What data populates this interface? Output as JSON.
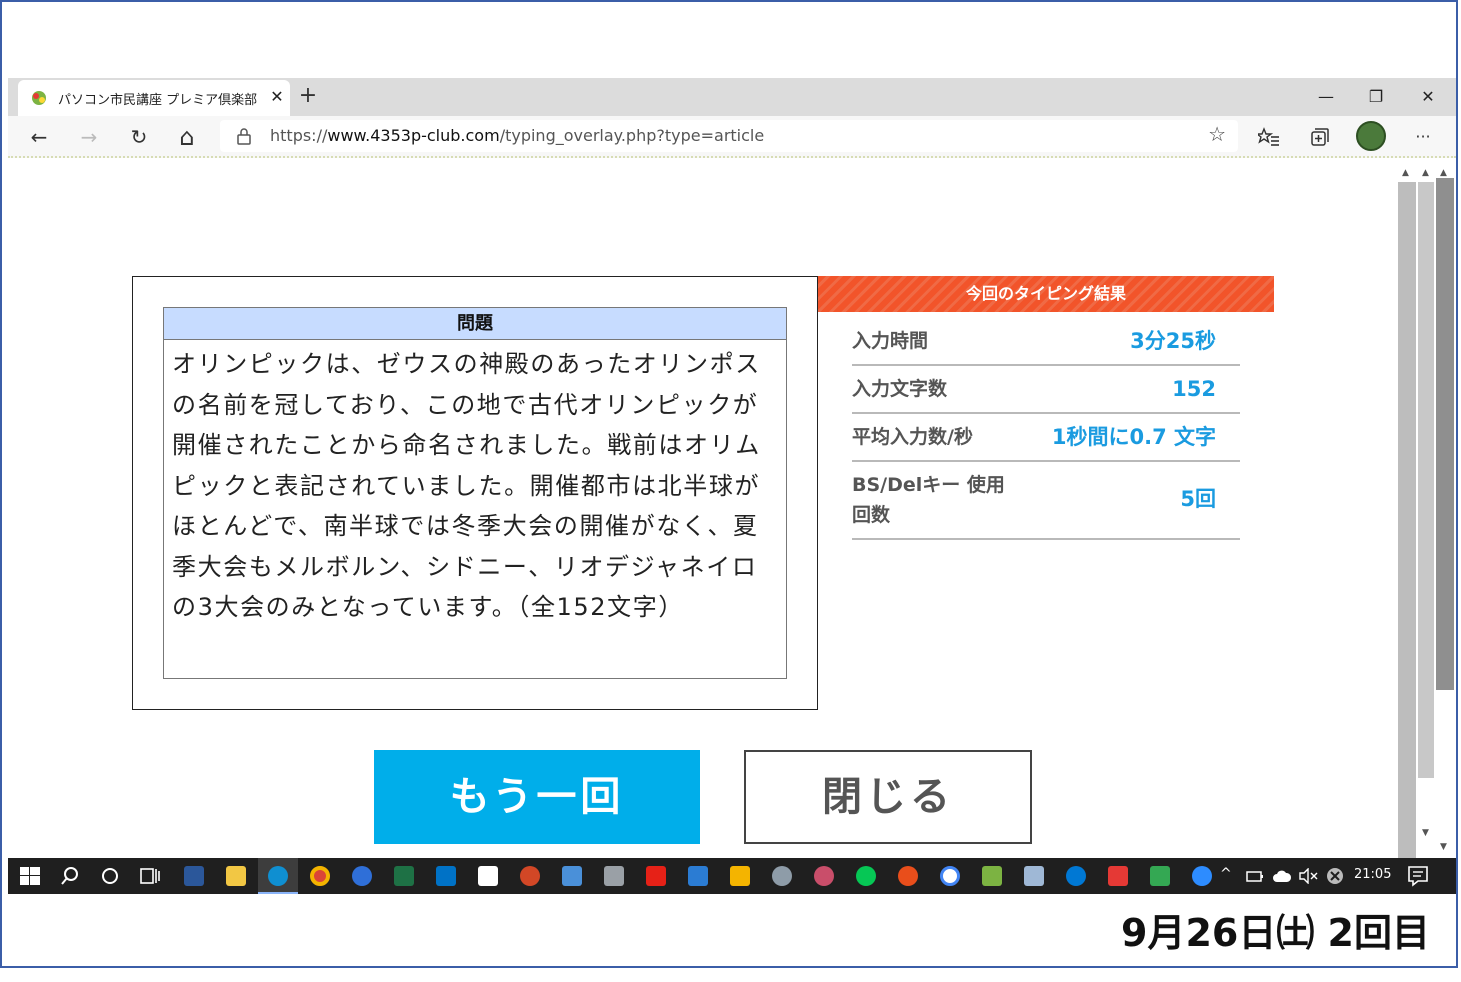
{
  "browser": {
    "tab_title": "パソコン市民講座 プレミア倶楽部 - タイ",
    "tab_close": "✕",
    "new_tab": "+",
    "window": {
      "minimize": "—",
      "restore": "❐",
      "close": "✕"
    },
    "url_prefix": "https://",
    "url_host": "www.4353p-club.com",
    "url_path": "/typing_overlay.php?type=article",
    "nav": {
      "back": "←",
      "forward": "→",
      "refresh": "↻",
      "home": "⌂",
      "favorites": "☆",
      "more": "···"
    }
  },
  "question": {
    "header": "問題",
    "text": "オリンピックは、ゼウスの神殿のあったオリンポスの名前を冠しており、この地で古代オリンピックが開催されたことから命名されました。戦前はオリムピックと表記されていました。開催都市は北半球がほとんどで、南半球では冬季大会の開催がなく、夏季大会もメルボルン、シドニー、リオデジャネイロの3大会のみとなっています。（全152文字）"
  },
  "result": {
    "header": "今回のタイピング結果",
    "rows": [
      {
        "label": "入力時間",
        "value": "3分25秒"
      },
      {
        "label": "入力文字数",
        "value": "152"
      },
      {
        "label": "平均入力数/秒",
        "value": "1秒間に0.7 文字"
      },
      {
        "label": "BS/Delキー 使用回数",
        "value": "5回"
      }
    ]
  },
  "buttons": {
    "retry": "もう一回",
    "close": "閉じる"
  },
  "taskbar": {
    "clock": "21:05"
  },
  "caption": "9月26日㈯ 2回目",
  "colors": {
    "accent_blue": "#00aeea",
    "result_header": "#f2542a",
    "value_blue": "#1a9be0",
    "question_header": "#c7dcff"
  }
}
